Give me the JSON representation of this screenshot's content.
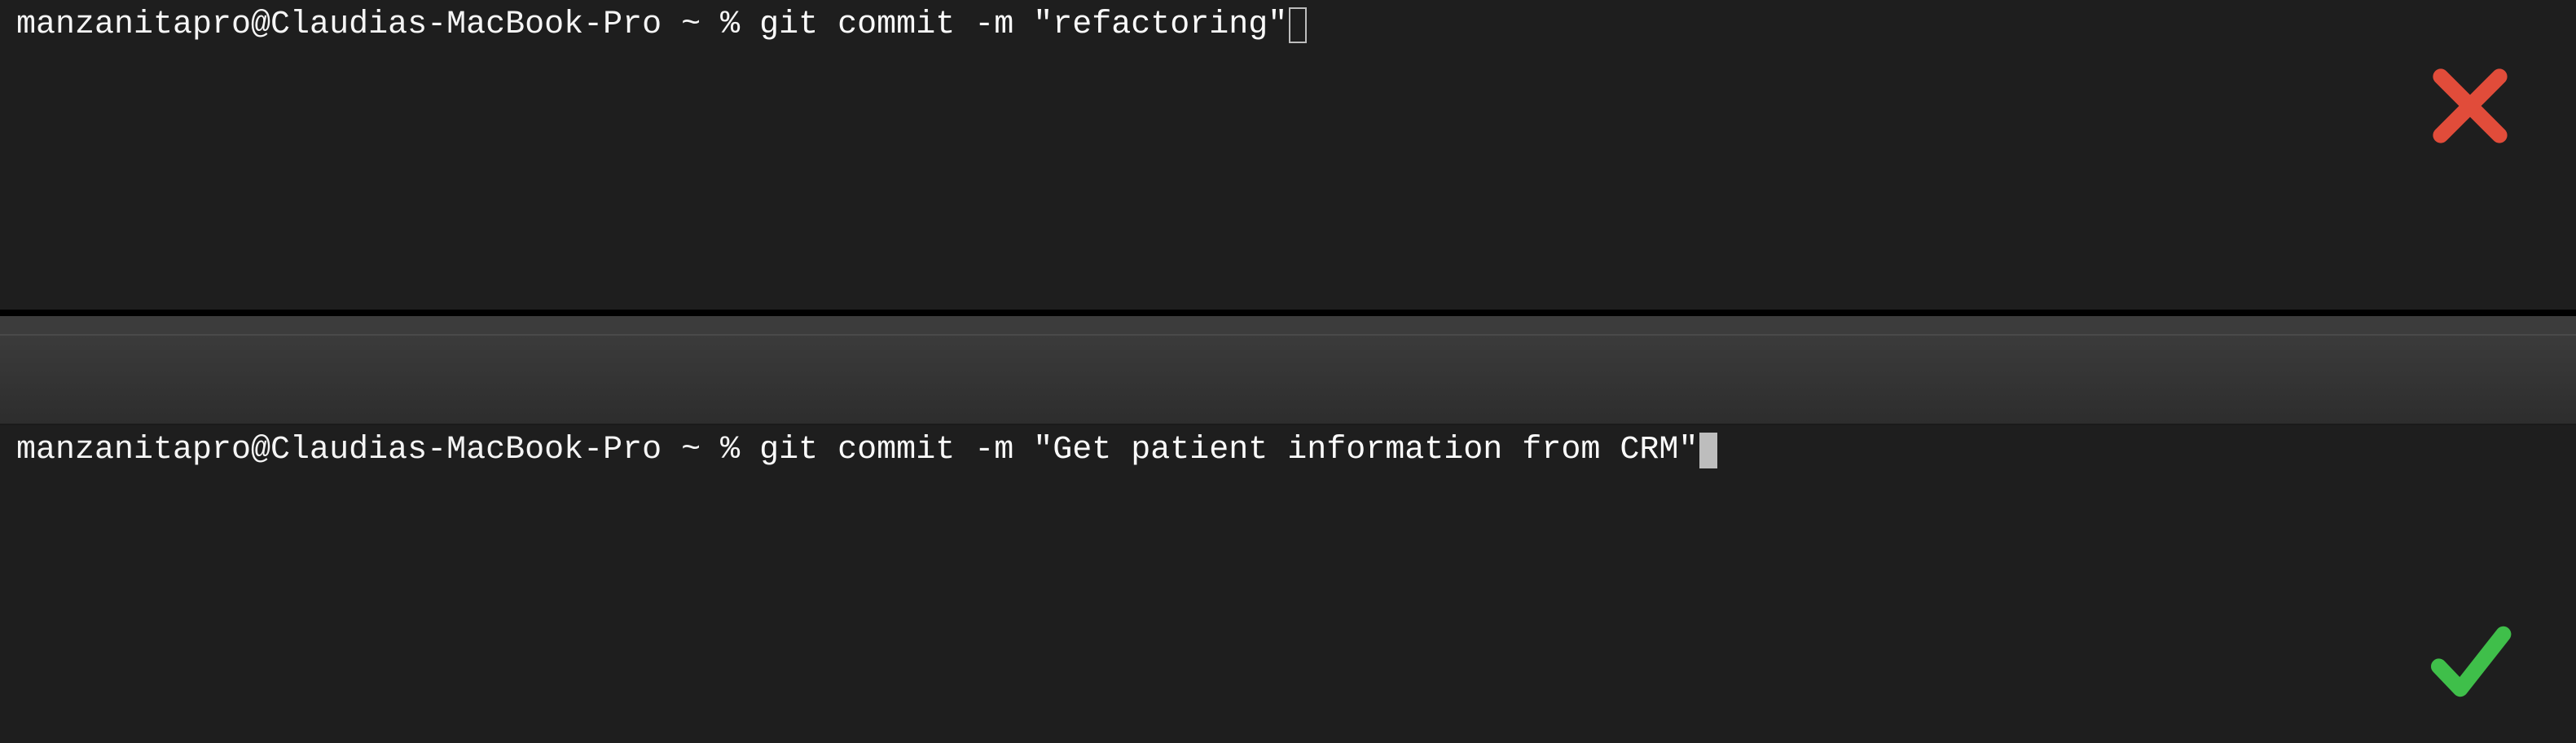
{
  "top": {
    "prompt": "manzanitapro@Claudias-MacBook-Pro ~ % ",
    "command": "git commit -m \"refactoring\"",
    "mark": "cross"
  },
  "bottom": {
    "prompt": "manzanitapro@Claudias-MacBook-Pro ~ % ",
    "command": "git commit -m \"Get patient information from CRM\"",
    "mark": "check"
  },
  "colors": {
    "cross": "#e14c3a",
    "check": "#3fbf4a"
  }
}
